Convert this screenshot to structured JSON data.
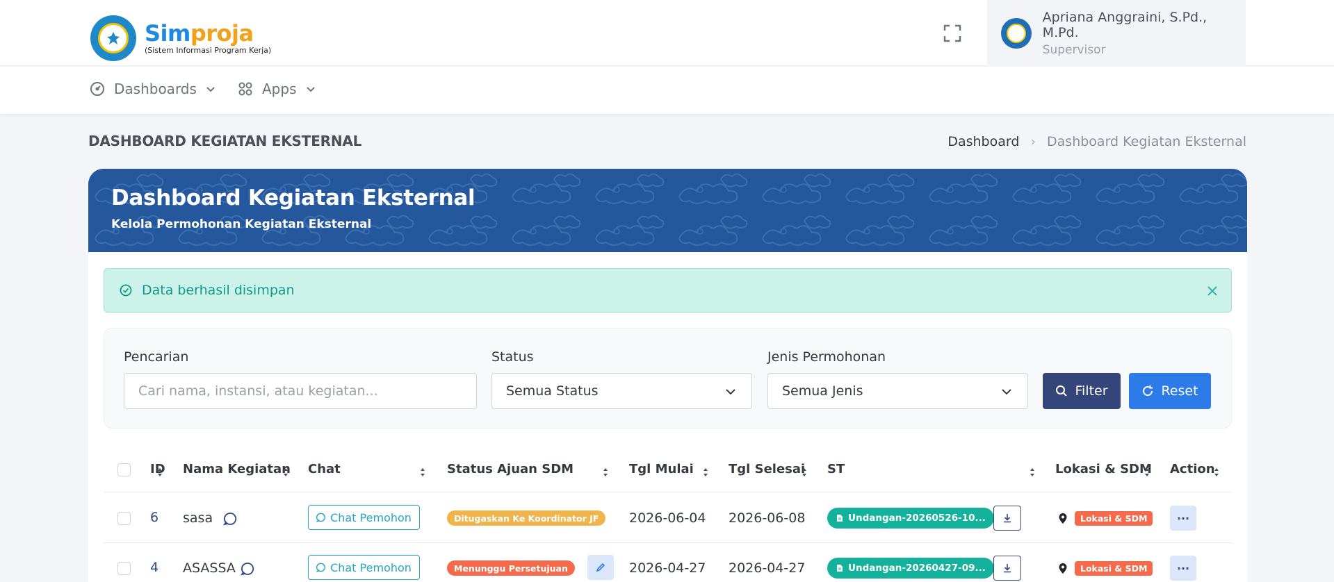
{
  "header": {
    "brand_part1": "Sim",
    "brand_part2": "proja",
    "brand_subtitle": "(Sistem Informasi Program Kerja)",
    "user_name": "Apriana Anggraini, S.Pd., M.Pd.",
    "user_role": "Supervisor",
    "icons": [
      "logo-seal",
      "fullscreen-icon",
      "avatar"
    ]
  },
  "nav": {
    "items": [
      {
        "label": "Dashboards",
        "icon": "speedometer-icon"
      },
      {
        "label": "Apps",
        "icon": "apps-grid-icon"
      }
    ]
  },
  "page": {
    "title": "DASHBOARD KEGIATAN EKSTERNAL",
    "breadcrumb_home": "Dashboard",
    "breadcrumb_current": "Dashboard Kegiatan Eksternal"
  },
  "banner": {
    "title": "Dashboard Kegiatan Eksternal",
    "subtitle": "Kelola Permohonan Kegiatan Eksternal"
  },
  "alert": {
    "message": "Data berhasil disimpan"
  },
  "filters": {
    "search_label": "Pencarian",
    "search_placeholder": "Cari nama, instansi, atau kegiatan...",
    "status_label": "Status",
    "status_value": "Semua Status",
    "jenis_label": "Jenis Permohonan",
    "jenis_value": "Semua Jenis",
    "filter_button": "Filter",
    "reset_button": "Reset"
  },
  "table": {
    "columns": {
      "id": "ID",
      "nama": "Nama Kegiatan",
      "chat": "Chat",
      "status": "Status Ajuan SDM",
      "tgl_mulai": "Tgl Mulai",
      "tgl_selesai": "Tgl Selesai",
      "st": "ST",
      "lokasi": "Lokasi & SDM",
      "action": "Action"
    },
    "rows": [
      {
        "id": "6",
        "nama": "sasa",
        "chat": "Chat Pemohon",
        "status": "Ditugaskan Ke Koordinator JF",
        "status_color": "#f1b44c",
        "tgl_mulai": "2026-06-04",
        "tgl_selesai": "2026-06-08",
        "st": "Undangan-20260526-10...",
        "lokasi": "Lokasi & SDM",
        "action": "···"
      },
      {
        "id": "4",
        "nama": "ASASSA",
        "chat": "Chat Pemohon",
        "status": "Menunggu Persetujuan",
        "status_color": "#f46a4a",
        "tgl_mulai": "2026-04-27",
        "tgl_selesai": "2026-04-27",
        "st": "Undangan-20260427-09...",
        "lokasi": "Lokasi & SDM",
        "action": "···"
      }
    ]
  }
}
